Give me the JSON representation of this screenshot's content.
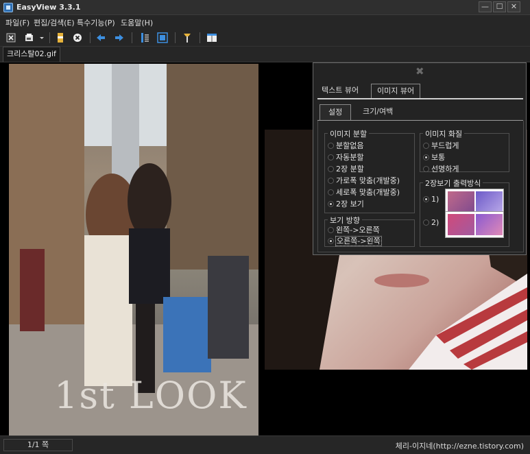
{
  "window": {
    "title": "EasyView  3.3.1",
    "controls": {
      "minimize": "—",
      "maximize": "☐",
      "close": "✕"
    }
  },
  "menu": {
    "items": [
      "파일(F)",
      "편집/검색(E)",
      "특수기능(P)",
      "도움말(H)"
    ]
  },
  "toolbar": {
    "icons": [
      "close-file-icon",
      "open-file-icon",
      "dropdown-arrow-icon",
      "bookmark-icon",
      "delete-icon",
      "back-arrow-icon",
      "forward-arrow-icon",
      "text-view-icon",
      "fit-screen-icon",
      "settings-icon",
      "layout-icon"
    ]
  },
  "document_tab": {
    "label": "크리스탈02.gif"
  },
  "viewer": {
    "left_image_caption": "1st LOOK"
  },
  "options_panel": {
    "close_glyph": "✖",
    "tabs": [
      "텍스트 뷰어",
      "이미지 뷰어"
    ],
    "active_tab": "이미지 뷰어",
    "subtabs": [
      "설정",
      "크기/여백"
    ],
    "active_subtab": "설정",
    "image_split": {
      "legend": "이미지 분할",
      "options": [
        "분할없음",
        "자동분할",
        "2장 분할",
        "가로폭 맞춤(개발중)",
        "세로폭 맞춤(개발중)",
        "2장 보기"
      ],
      "selected": "2장 보기"
    },
    "view_direction": {
      "legend": "보기 방향",
      "options": [
        "왼쪽->오른쪽",
        "오른쪽->왼쪽"
      ],
      "selected": "오른쪽->왼쪽"
    },
    "image_quality": {
      "legend": "이미지 화질",
      "options": [
        "부드럽게",
        "보통",
        "선명하게"
      ],
      "selected": "보통"
    },
    "two_page_output": {
      "legend": "2장보기 출력방식",
      "options": [
        "1)",
        "2)"
      ],
      "selected": "1)"
    }
  },
  "status": {
    "page": "1/1 쪽",
    "credit": "체리-이지네(http://ezne.tistory.com)"
  },
  "colors": {
    "background": "#1b1b1b",
    "panel": "#232323",
    "text": "#e2e2e2"
  }
}
